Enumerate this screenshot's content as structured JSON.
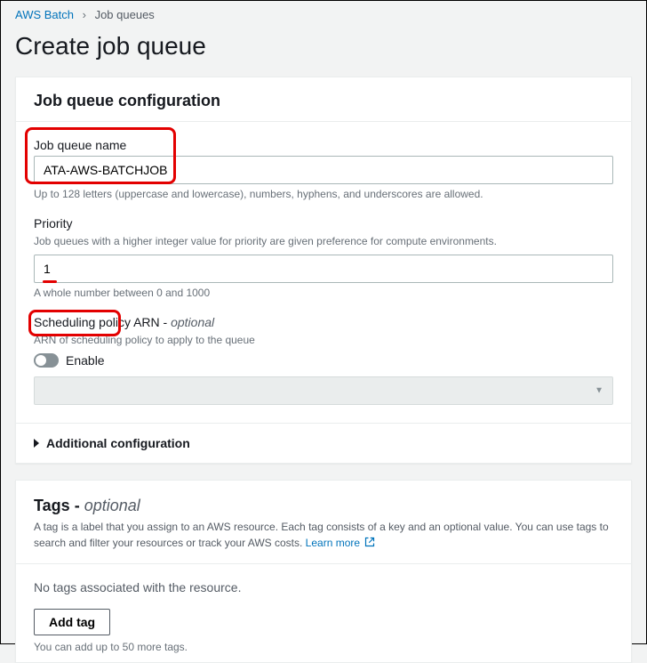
{
  "breadcrumb": {
    "root": "AWS Batch",
    "current": "Job queues"
  },
  "page_title": "Create job queue",
  "config": {
    "heading": "Job queue configuration",
    "name": {
      "label": "Job queue name",
      "value": "ATA-AWS-BATCHJOB",
      "help": "Up to 128 letters (uppercase and lowercase), numbers, hyphens, and underscores are allowed."
    },
    "priority": {
      "label": "Priority",
      "sublabel": "Job queues with a higher integer value for priority are given preference for compute environments.",
      "value": "1",
      "help": "A whole number between 0 and 1000"
    },
    "scheduling": {
      "label_main": "Scheduling policy ARN",
      "label_suffix": "optional",
      "sublabel": "ARN of scheduling policy to apply to the queue",
      "toggle_label": "Enable"
    },
    "additional": "Additional configuration"
  },
  "tags": {
    "heading_main": "Tags",
    "heading_suffix": "optional",
    "description_pre": "A tag is a label that you assign to an AWS resource. Each tag consists of a key and an optional value. You can use tags to search and filter your resources or track your AWS costs. ",
    "learn_more": "Learn more",
    "empty": "No tags associated with the resource.",
    "add_button": "Add tag",
    "limit": "You can add up to 50 more tags."
  }
}
